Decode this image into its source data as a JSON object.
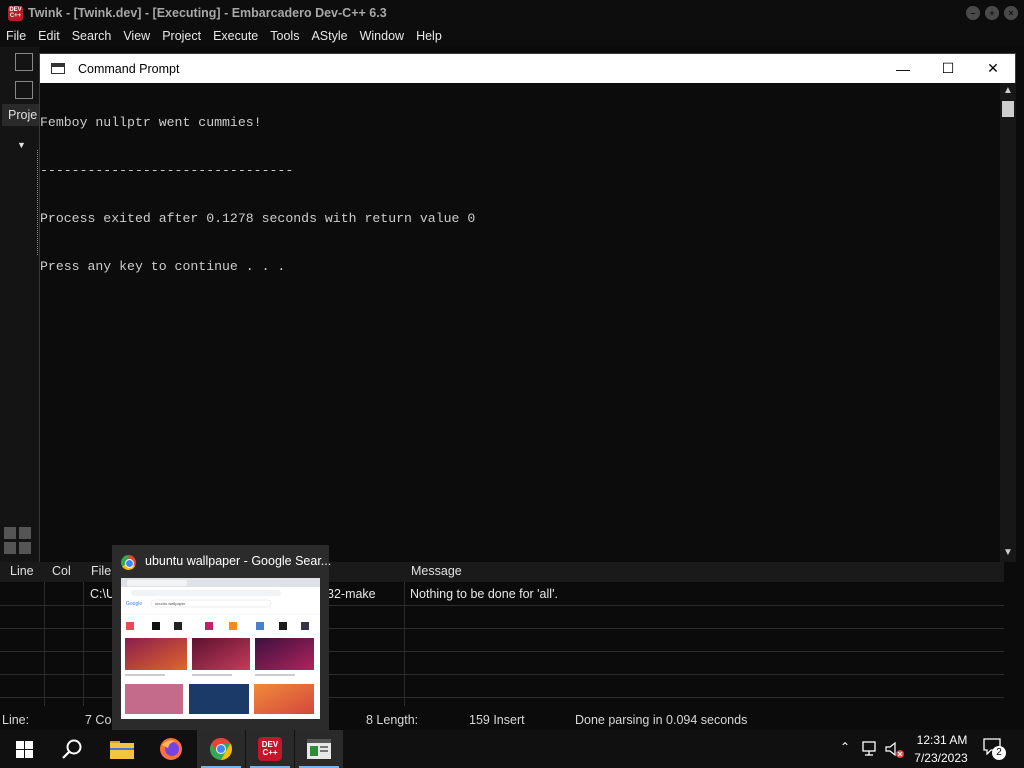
{
  "ide": {
    "title": "Twink - [Twink.dev] - [Executing] - Embarcadero Dev-C++ 6.3",
    "logo_text": "DEV C++",
    "menu": [
      "File",
      "Edit",
      "Search",
      "View",
      "Project",
      "Execute",
      "Tools",
      "AStyle",
      "Window",
      "Help"
    ],
    "project_tab_label": "Proje"
  },
  "console": {
    "title": "Command Prompt",
    "minimize_glyph": "—",
    "maximize_glyph": "☐",
    "close_glyph": "✕",
    "lines": [
      "Femboy nullptr went cummies!",
      "--------------------------------",
      "Process exited after 0.1278 seconds with return value 0",
      "Press any key to continue . . ."
    ]
  },
  "messages": {
    "headers": {
      "line": "Line",
      "col": "Col",
      "file": "File",
      "message": "Message"
    },
    "row": {
      "file": "C:\\U",
      "file_tail": "32-make",
      "message": "Nothing to be done for 'all'."
    }
  },
  "statusbar": {
    "line_label": "Line:",
    "col_value": "7 Col",
    "sel_value": "8 Length:",
    "length_value": "159 Insert",
    "parse_status": "Done parsing in 0.094 seconds"
  },
  "preview": {
    "title": "ubuntu wallpaper - Google Sear...",
    "search_query": "ubuntu wallpaper",
    "google_logo": "Google"
  },
  "taskbar": {
    "time": "12:31 AM",
    "date": "7/23/2023",
    "notification_count": "2",
    "devcpp_icon_text": "DEV C++"
  },
  "colors": {
    "devcpp_red": "#c3162b",
    "taskbar_accent": "#7ab4ea"
  }
}
